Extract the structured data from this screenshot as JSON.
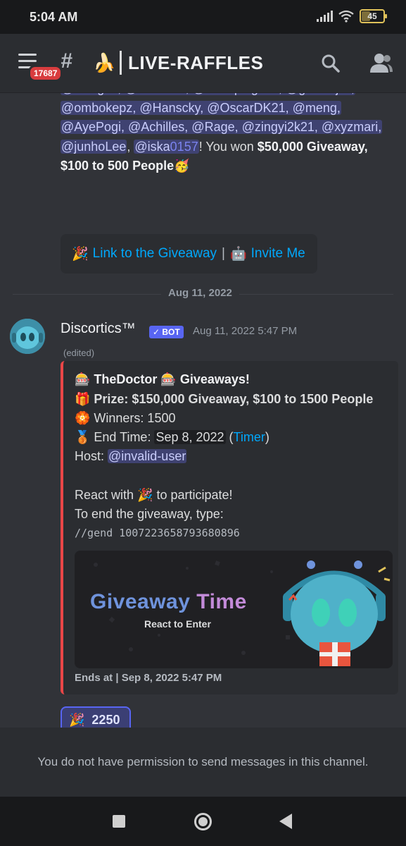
{
  "status_bar": {
    "time": "5:04 AM",
    "battery": "45"
  },
  "header": {
    "badge_count": "17687",
    "channel_emoji": "🍌",
    "channel_name": "LIVE-RAFFLES",
    "icons": [
      "menu-icon",
      "channel-hash-icon",
      "search-icon",
      "members-icon"
    ]
  },
  "prev_message": {
    "mentions_line1": "@Oxagus, @Random, @awkspinguim, @gemskjov,",
    "mentions_line2": "@ombokepz, @Hanscky, @OscarDK21, @meng,",
    "mentions_line3": "@AyePogi, @Achilles, @Rage, @zingyi2k21, @xyzmari,",
    "mention_junho": "@junhoLee",
    "mention_iska": "@iska",
    "mention_iska_link": "0157",
    "won_text": "!  You won ",
    "prize_text": "$50,000 Giveaway,",
    "prize_text2": "$100 to 500 People",
    "prize_emoji": "🥳",
    "link_giveaway": "Link to the Giveaway",
    "link_invite": "Invite Me",
    "link_giveaway_emoji": "🎉",
    "link_invite_emoji": "🤖"
  },
  "date_divider": "Aug 11, 2022",
  "message": {
    "author": "Discortics™",
    "bot_tag": "✓ BOT",
    "timestamp": "Aug 11, 2022 5:47 PM",
    "edited": "(edited)",
    "embed": {
      "title": "🎰 TheDoctor 🎰 Giveaways!",
      "prize": "🎁 Prize: $150,000 Giveaway, $100 to 1500 People",
      "winners": "🏵️ Winners: 1500",
      "end_time_label": "🥉 End Time: ",
      "end_time_value": "Sep 8, 2022",
      "timer_open": " (",
      "timer_link": "Timer",
      "timer_close": ")",
      "host_label": "Host: ",
      "host_mention": "@invalid-user",
      "react_text1": "React with ",
      "react_emoji": "🎉",
      "react_text2": " to participate!",
      "end_instructions": "To end the giveaway, type:",
      "command": "//gend 1007223658793680896",
      "image_title_1": "Giveaway",
      "image_title_2": "Time",
      "image_subtitle": "React to Enter",
      "footer": "Ends at | Sep 8, 2022 5:47 PM"
    },
    "reaction": {
      "emoji": "🎉",
      "count": "2250"
    }
  },
  "composer": {
    "notice": "You do not have permission to send messages in this channel."
  },
  "colors": {
    "embed_accent": "#ea4647",
    "mention_bg": "#3f4271",
    "link": "#00a8fc",
    "bot_tag": "#5865f2"
  }
}
